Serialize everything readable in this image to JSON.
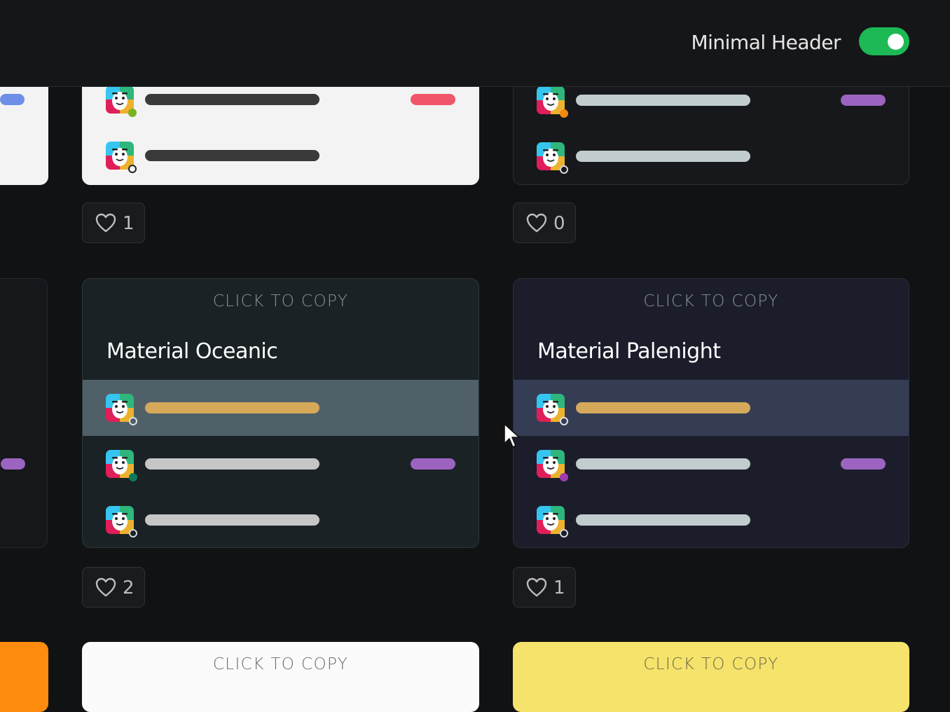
{
  "header": {
    "toggle_label": "Minimal Header",
    "toggle_on": true,
    "toggle_color": "#1db954"
  },
  "cards": {
    "light_top": {
      "likes": "1",
      "accent_pill": "#f0566a",
      "text_bar": "#3a3a3a"
    },
    "dark_top": {
      "likes": "0",
      "accent_pill": "#9c64c0",
      "text_bar": "#c1ccce"
    },
    "material_oceanic": {
      "copy_label": "CLICK TO COPY",
      "title": "Material Oceanic",
      "likes": "2",
      "active_row_bg": "#4f6069",
      "active_bar": "#d6a85a",
      "text_bar": "#c6c6c6",
      "accent_pill": "#9c64c0",
      "status_colors": [
        "outline",
        "#0e7a5b",
        "outline"
      ]
    },
    "material_palenight": {
      "copy_label": "CLICK TO COPY",
      "title": "Material Palenight",
      "likes": "1",
      "active_row_bg": "#353d55",
      "active_bar": "#d6a85a",
      "text_bar": "#c1ccce",
      "accent_pill": "#9c64c0",
      "status_colors": [
        "outline",
        "#a13ab0",
        "outline"
      ]
    },
    "bottom_white": {
      "copy_label": "CLICK TO COPY"
    },
    "bottom_yellow": {
      "copy_label": "CLICK TO COPY"
    }
  },
  "icons": [
    "heart-icon",
    "slack-avatar-icon",
    "cursor-icon"
  ]
}
